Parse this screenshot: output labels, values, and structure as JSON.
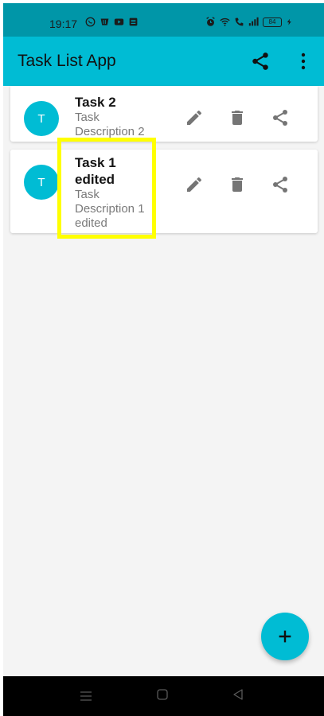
{
  "status_bar": {
    "time": "19:17",
    "left_icons": [
      "whatsapp-icon",
      "app-icon",
      "youtube-icon",
      "news-icon"
    ],
    "right_icons": [
      "alarm-icon",
      "wifi-icon",
      "call-icon",
      "signal-icon"
    ],
    "battery_level": "84"
  },
  "app_bar": {
    "title": "Task List App",
    "share_icon": "share-icon",
    "more_icon": "more-vert-icon"
  },
  "tasks": [
    {
      "avatar_letter": "T",
      "title": "Task 2",
      "description": "Task Description 2"
    },
    {
      "avatar_letter": "T",
      "title": "Task 1 edited",
      "description": "Task Description 1 edited"
    }
  ],
  "task_actions": [
    "edit-icon",
    "delete-icon",
    "share-icon"
  ],
  "fab": {
    "icon": "add-icon"
  },
  "nav_bar": {
    "icons": [
      "menu-icon",
      "home-icon",
      "back-icon"
    ]
  },
  "colors": {
    "primary": "#00bcd4",
    "status_bar": "#0096a8",
    "highlight": "#ffff00",
    "icon_grey": "#757575"
  }
}
